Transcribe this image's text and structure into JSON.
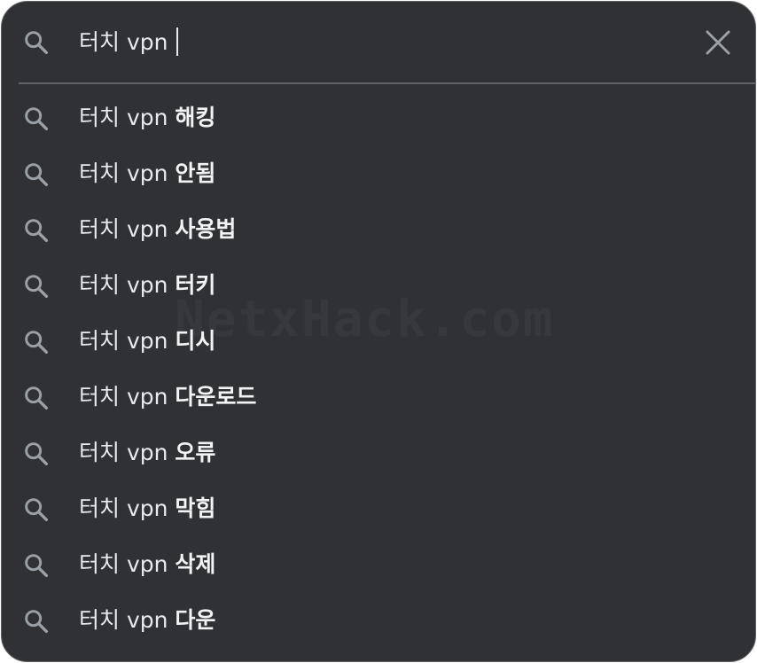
{
  "search": {
    "query": "터치 vpn",
    "icon": "search-icon",
    "clear_icon": "close-icon"
  },
  "suggestions": [
    {
      "prefix": "터치 vpn",
      "completion": "해킹"
    },
    {
      "prefix": "터치 vpn",
      "completion": "안됨"
    },
    {
      "prefix": "터치 vpn",
      "completion": "사용법"
    },
    {
      "prefix": "터치 vpn",
      "completion": "터키"
    },
    {
      "prefix": "터치 vpn",
      "completion": "디시"
    },
    {
      "prefix": "터치 vpn",
      "completion": "다운로드"
    },
    {
      "prefix": "터치 vpn",
      "completion": "오류"
    },
    {
      "prefix": "터치 vpn",
      "completion": "막힘"
    },
    {
      "prefix": "터치 vpn",
      "completion": "삭제"
    },
    {
      "prefix": "터치 vpn",
      "completion": "다운"
    }
  ],
  "watermark": "NetxHack.com",
  "colors": {
    "panel_background": "#303134",
    "text": "#e8eaed",
    "icon": "#9aa0a6",
    "divider": "#5f6368"
  }
}
